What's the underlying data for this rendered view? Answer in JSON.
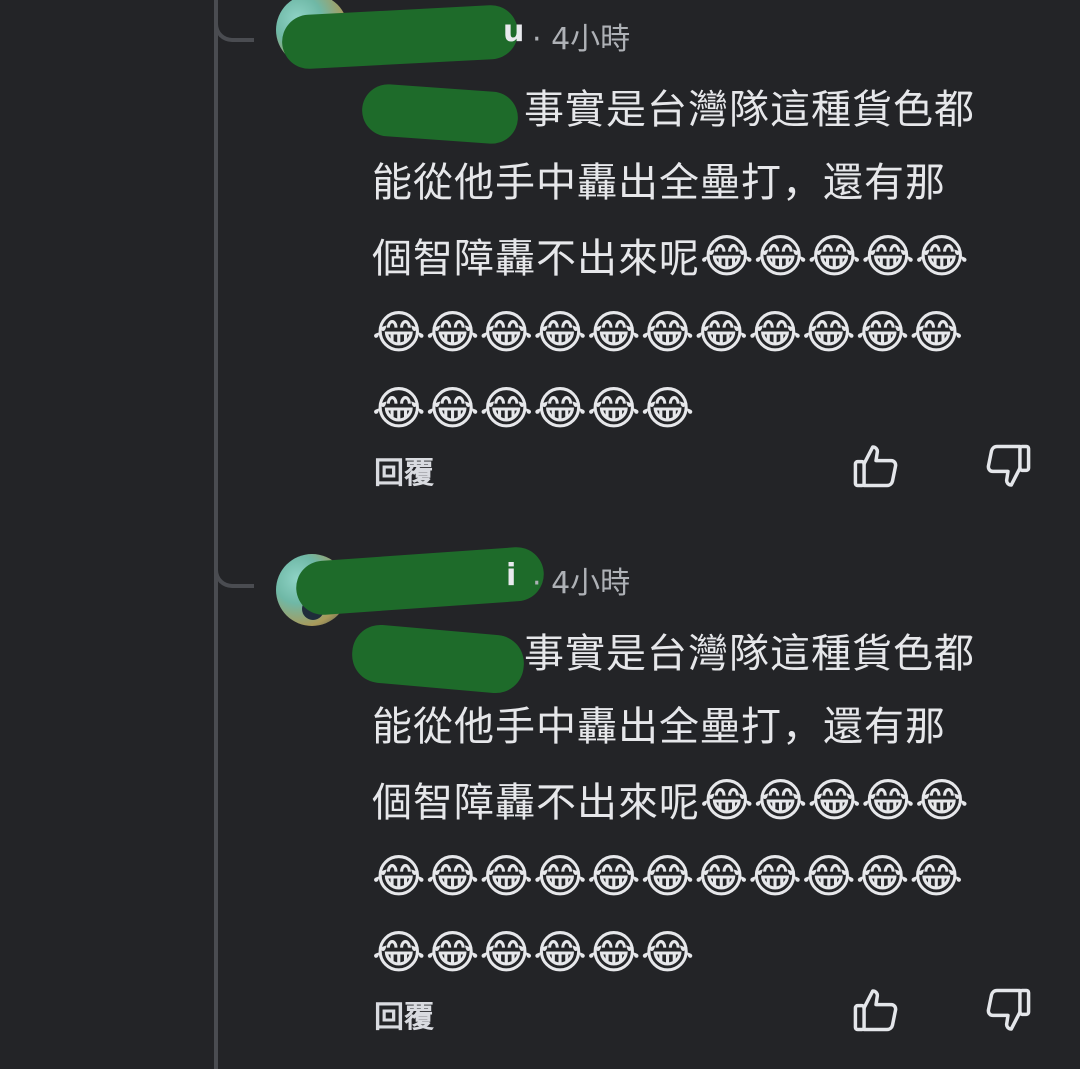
{
  "comments": [
    {
      "username_visible_tail": "u",
      "time": "· 4小時",
      "body_line1": "事實是台灣隊這種貨色都",
      "body_line2": "能從他手中轟出全壘打，還有那",
      "body_line3": "個智障轟不出來呢",
      "emoji_line3": "😂😂😂😂😂",
      "emoji_line4": "😂😂😂😂😂😂😂😂😂😂😂",
      "emoji_line5": "😂😂😂😂😂😂",
      "reply_label": "回覆",
      "like_icon": "thumbs-up-icon",
      "dislike_icon": "thumbs-down-icon"
    },
    {
      "username_visible_tail": "i",
      "time": "· 4小時",
      "body_line1": "事實是台灣隊這種貨色都",
      "body_line2": "能從他手中轟出全壘打，還有那",
      "body_line3": "個智障轟不出來呢",
      "emoji_line3": "😂😂😂😂😂",
      "emoji_line4": "😂😂😂😂😂😂😂😂😂😂😂",
      "emoji_line5": "😂😂😂😂😂😂",
      "reply_label": "回覆",
      "like_icon": "thumbs-up-icon",
      "dislike_icon": "thumbs-down-icon"
    }
  ],
  "colors": {
    "background": "#232427",
    "text": "#e6e7ea",
    "meta": "#aeb1b6",
    "redaction": "#1e6b2a",
    "thread_line": "#4a4c51"
  }
}
